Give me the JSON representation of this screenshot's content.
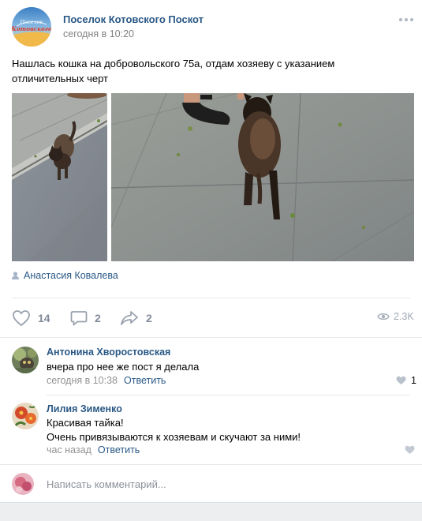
{
  "post": {
    "group_name": "Поселок Котовского Поскот",
    "date": "сегодня в 10:20",
    "avatar_logo_text": "Котовского",
    "text_line1": "Нашлась кошка на добровольского 75а, отдам хозяеву с указанием",
    "text_line2": "отличительных черт",
    "signer": "Анастасия Ковалева"
  },
  "actions": {
    "likes": "14",
    "comments": "2",
    "shares": "2",
    "views": "2.3K"
  },
  "comments": [
    {
      "author": "Антонина Хворостовская",
      "text": "вчера про нее же пост я делала",
      "time": "сегодня в 10:38",
      "reply": "Ответить",
      "likes": "1"
    },
    {
      "author": "Лилия Зименко",
      "text_line1": "Красивая тайка!",
      "text_line2": "Очень привязываются к хозяевам и скучают за ними!",
      "time": "час назад",
      "reply": "Ответить"
    }
  ],
  "composer": {
    "placeholder": "Написать комментарий..."
  },
  "icons": {
    "more": "more-icon",
    "signer": "user-icon",
    "like": "heart-icon",
    "comment": "comment-icon",
    "share": "share-icon",
    "views": "eye-icon"
  },
  "colors": {
    "link": "#2a5885",
    "meta": "#828282",
    "icon": "#828a99",
    "divider": "#e7e8ec",
    "page_bg": "#edeef0"
  }
}
